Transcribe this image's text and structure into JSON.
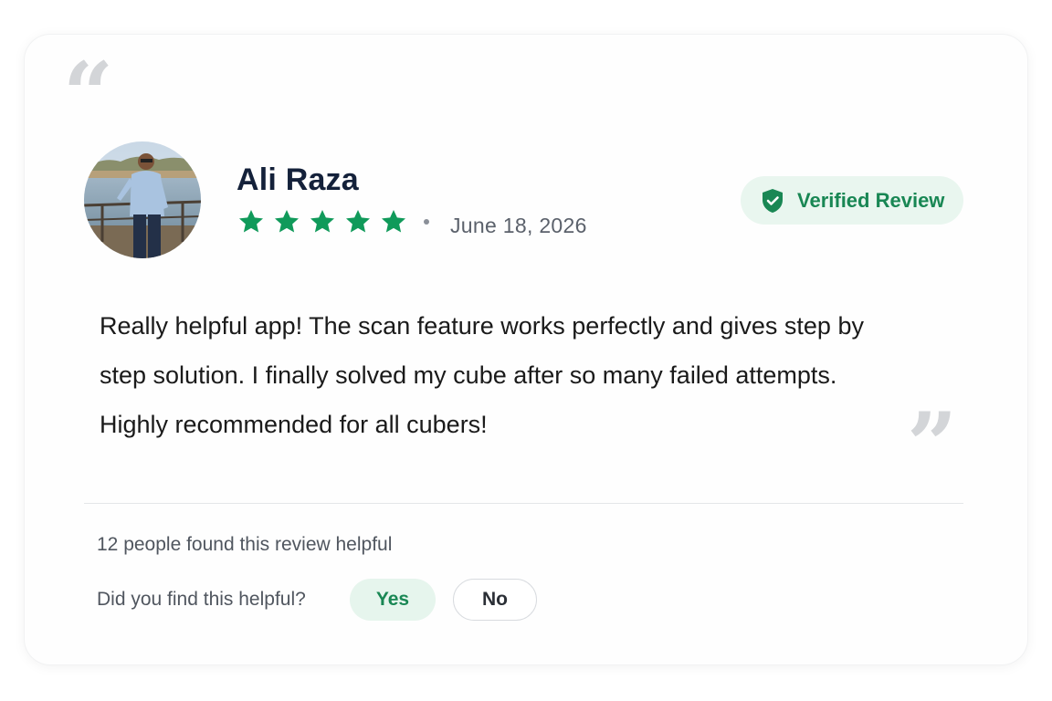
{
  "review": {
    "open_quote": "“",
    "close_quote": "”",
    "reviewer_name": "Ali Raza",
    "rating": 5,
    "rating_max": 5,
    "date": "June 18, 2026",
    "badge_label": "Verified Review",
    "badge_icon": "shield-check-icon",
    "text": "Really helpful app! The scan feature works perfectly and gives step by step solution. I finally solved my cube after so many failed attempts. Highly recommended for all cubers!"
  },
  "helpful": {
    "count_text": "12 people found this review helpful",
    "question": "Did you find this helpful?",
    "yes_label": "Yes",
    "no_label": "No"
  },
  "colors": {
    "accent_green": "#198754",
    "star_green": "#109a5a",
    "badge_bg": "#e9f6ef",
    "name_color": "#14213a"
  }
}
